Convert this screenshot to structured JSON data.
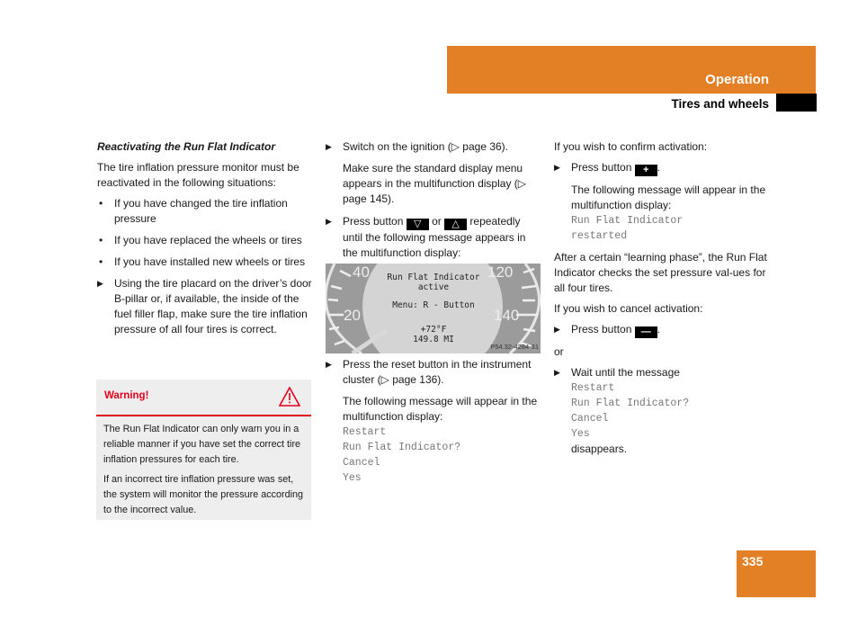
{
  "header": {
    "section": "Operation",
    "subsection": "Tires and wheels",
    "accent_color": "#e37f24"
  },
  "col1": {
    "heading": "Reactivating the Run Flat Indicator",
    "intro": "The tire inflation pressure monitor must be reactivated in the following situations:",
    "bullets": [
      "If you have changed the tire inflation pressure",
      "If you have replaced the wheels or tires",
      "If you have installed new wheels or tires"
    ],
    "step": "Using the tire placard on the driver’s door B-pillar or, if available, the inside of the fuel filler flap, make sure the tire inflation pressure of all four tires is correct."
  },
  "warning": {
    "label": "Warning!",
    "icon": "warning-triangle-icon",
    "color": "#e3001b",
    "paragraphs": [
      "The Run Flat Indicator can only warn you in a reliable manner if you have set the correct tire inflation pressures for each tire.",
      "If an incorrect tire inflation pressure was set, the system will monitor the pressure according to the incorrect value."
    ]
  },
  "col2": {
    "step1": "Switch on the ignition (▷ page 36).",
    "step1_note": "Make sure the standard display menu appears in the multifunction display (▷ page 145).",
    "step2_a": "Press button",
    "step2_or": "or",
    "step2_b": "repeatedly until the following message appears in the multifunction display:",
    "step3": "Press the reset button in the instrument cluster (▷ page 136).",
    "step3_note": "The following message will appear in the multifunction display:",
    "message": [
      "Restart",
      "Run Flat Indicator?",
      "Cancel",
      "Yes"
    ]
  },
  "gauge": {
    "left_ticks": [
      "40",
      "20"
    ],
    "right_ticks": [
      "120",
      "140"
    ],
    "display_line1": "Run Flat Indicator",
    "display_line2": "active",
    "display_line3": "Menu: R - Button",
    "temperature": "+72°F",
    "odometer": "149.8 MI",
    "figure_id": "P54.32-4284-31"
  },
  "col3": {
    "confirm_intro": "If you wish to confirm activation:",
    "press_button": "Press button",
    "confirm_note": "The following message will appear in the multifunction display:",
    "confirm_message": [
      "Run Flat Indicator",
      "restarted"
    ],
    "learning": "After a certain “learning phase”, the Run Flat Indicator checks the set pressure val-ues for all four tires.",
    "cancel_intro": "If you wish to cancel activation:",
    "or": "or",
    "wait": "Wait until the message",
    "wait_message": [
      "Restart",
      "Run Flat Indicator?",
      "Cancel",
      "Yes"
    ],
    "disappears": "disappears."
  },
  "footer": {
    "page_number": "335"
  }
}
